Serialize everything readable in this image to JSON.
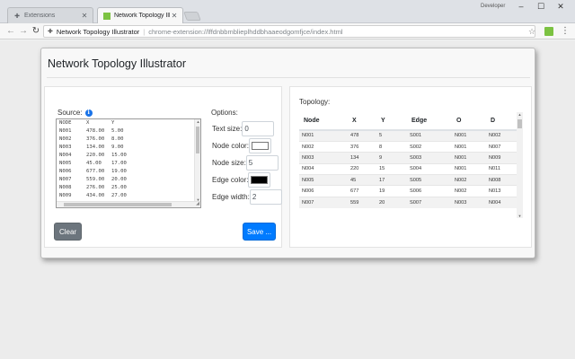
{
  "browser": {
    "tabs": [
      {
        "title": "Extensions",
        "active": false
      },
      {
        "title": "Network Topology Illustr",
        "active": true
      }
    ],
    "profile": "Developer",
    "site_name": "Network Topology Illustrator",
    "url": "chrome-extension://lffdnbbmblieplhddbhaaeodgomfjce/index.html",
    "accent": "#7cc242"
  },
  "app": {
    "title": "Network Topology Illustrator",
    "source_label": "Source:",
    "source_lines": [
      [
        "NODE",
        "X",
        "Y"
      ],
      [
        "N001",
        "478.00",
        "5.00"
      ],
      [
        "N002",
        "376.00",
        "8.00"
      ],
      [
        "N003",
        "134.00",
        "9.00"
      ],
      [
        "N004",
        "220.00",
        "15.00"
      ],
      [
        "N005",
        "45.00",
        "17.00"
      ],
      [
        "N006",
        "677.00",
        "19.00"
      ],
      [
        "N007",
        "559.00",
        "20.00"
      ],
      [
        "N008",
        "276.00",
        "25.00"
      ],
      [
        "N009",
        "434.00",
        "27.00"
      ]
    ],
    "options": {
      "title": "Options:",
      "text_size_label": "Text size:",
      "text_size_value": "0",
      "node_color_label": "Node color:",
      "node_color_value": "#ffffff",
      "node_size_label": "Node size:",
      "node_size_value": "5",
      "edge_color_label": "Edge color:",
      "edge_color_value": "#000000",
      "edge_width_label": "Edge width:",
      "edge_width_value": "2"
    },
    "buttons": {
      "clear": "Clear",
      "save": "Save ..."
    },
    "colors": {
      "clear_bg": "#6c757d",
      "save_bg": "#007bff"
    },
    "topology": {
      "label": "Topology:",
      "headers": [
        "Node",
        "X",
        "Y",
        "Edge",
        "O",
        "D"
      ],
      "rows": [
        [
          "N001",
          "478",
          "5",
          "S001",
          "N001",
          "N002"
        ],
        [
          "N002",
          "376",
          "8",
          "S002",
          "N001",
          "N007"
        ],
        [
          "N003",
          "134",
          "9",
          "S003",
          "N001",
          "N009"
        ],
        [
          "N004",
          "220",
          "15",
          "S004",
          "N001",
          "N011"
        ],
        [
          "N005",
          "45",
          "17",
          "S005",
          "N002",
          "N008"
        ],
        [
          "N006",
          "677",
          "19",
          "S006",
          "N002",
          "N013"
        ],
        [
          "N007",
          "559",
          "20",
          "S007",
          "N003",
          "N004"
        ]
      ]
    }
  }
}
